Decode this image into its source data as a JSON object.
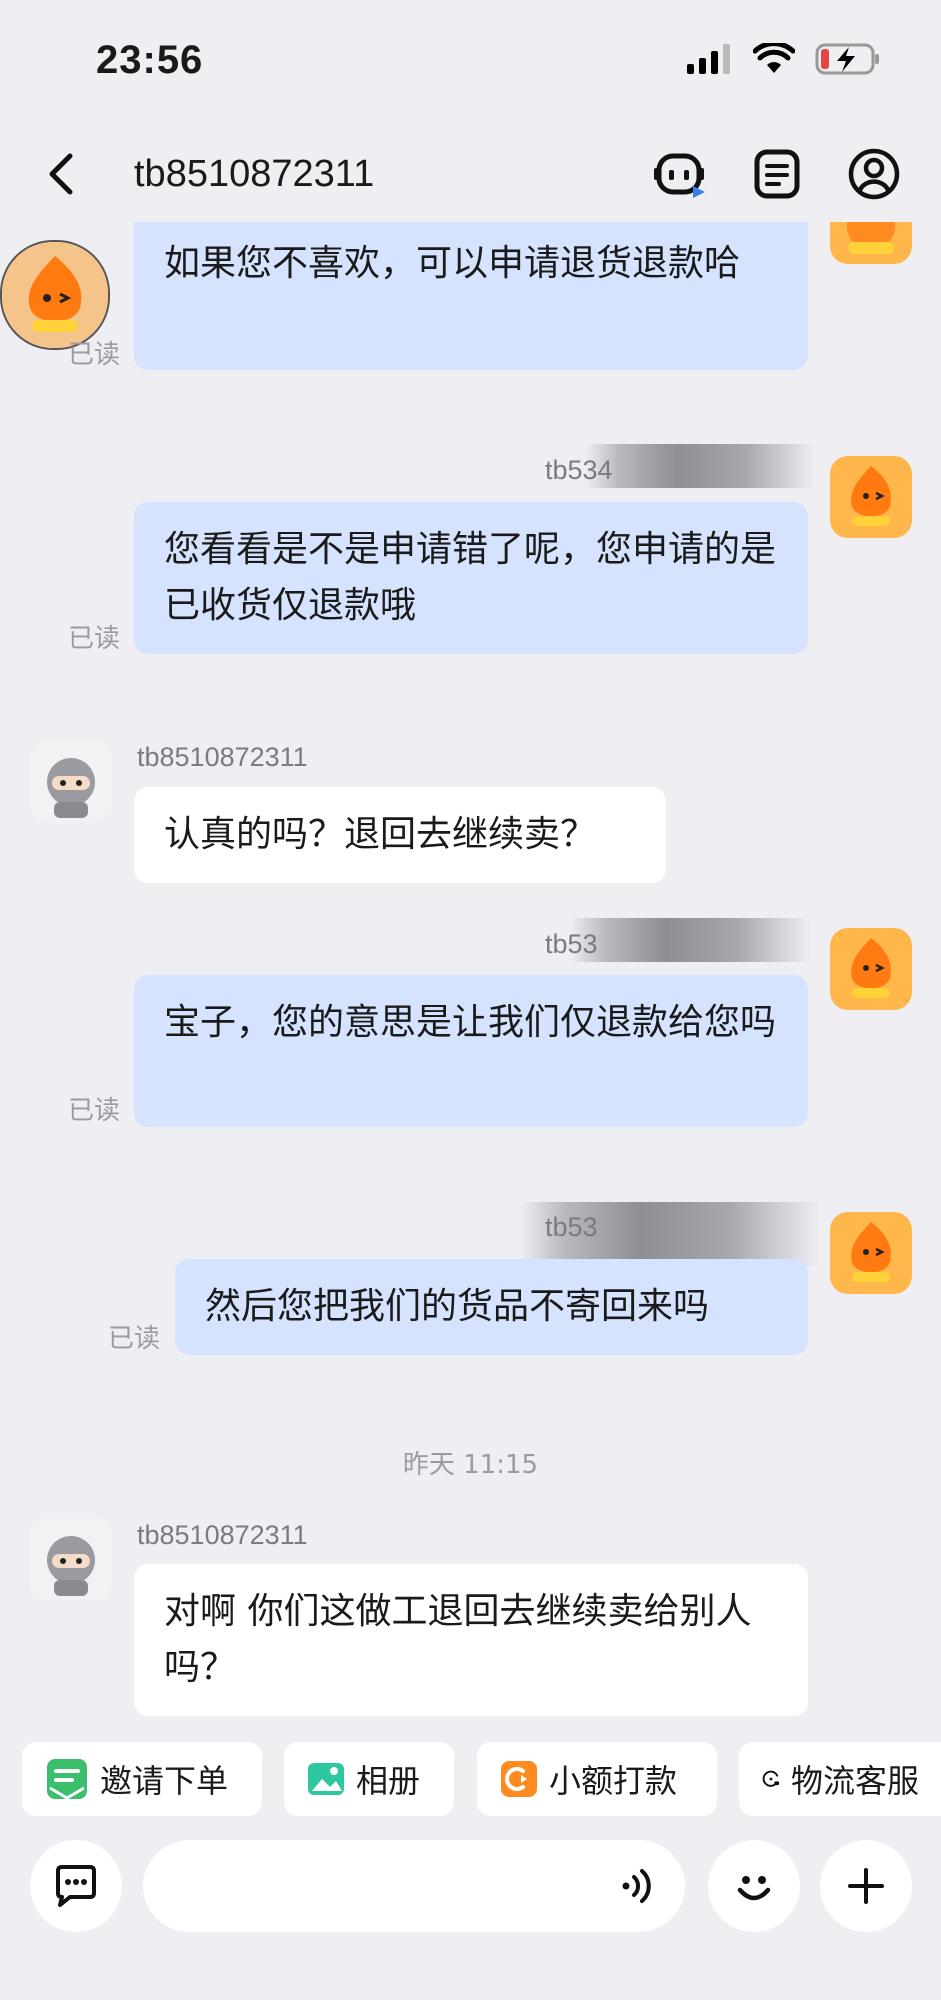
{
  "status_bar": {
    "time": "23:56"
  },
  "header": {
    "title": "tb8510872311"
  },
  "messages": [
    {
      "text": "如果您不喜欢，可以申请退货退款哈",
      "read": "已读"
    },
    {
      "sender": "tb534",
      "text": "您看看是不是申请错了呢，您申请的是已收货仅退款哦",
      "read": "已读"
    },
    {
      "sender": "tb8510872311",
      "text": "认真的吗？退回去继续卖？"
    },
    {
      "sender": "tb53",
      "text": "宝子，您的意思是让我们仅退款给您吗",
      "read": "已读"
    },
    {
      "sender": "tb53",
      "text": "然后您把我们的货品不寄回来吗",
      "read": "已读"
    },
    {
      "time_separator": "昨天 11:15"
    },
    {
      "sender": "tb8510872311",
      "text": "对啊 你们这做工退回去继续卖给别人吗？"
    }
  ],
  "quick_actions": [
    {
      "label": "邀请下单",
      "icon": "invite-order-icon"
    },
    {
      "label": "相册",
      "icon": "album-icon"
    },
    {
      "label": "小额打款",
      "icon": "small-payment-icon"
    },
    {
      "label": "物流客服",
      "icon": "logistics-service-icon"
    }
  ],
  "input": {
    "placeholder": ""
  },
  "colors": {
    "outgoing_bubble": "#d5e3ff",
    "incoming_bubble": "#ffffff",
    "background": "#eeeef3",
    "accent_orange": "#f7931e"
  }
}
